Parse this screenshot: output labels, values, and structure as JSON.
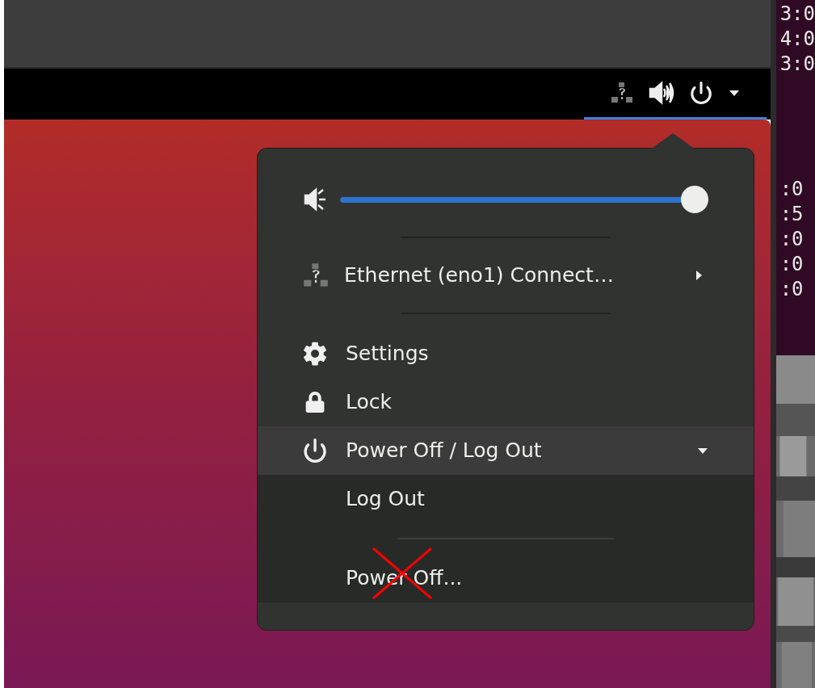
{
  "top_panel": {
    "status_menu_open": true
  },
  "menu": {
    "volume": {
      "level": 1
    },
    "network": {
      "label": "Ethernet (eno1) Connect…"
    },
    "items": [
      {
        "kind": "settings",
        "label": "Settings",
        "selected": false
      },
      {
        "kind": "lock",
        "label": "Lock",
        "selected": false
      },
      {
        "kind": "power",
        "label": "Power Off / Log Out",
        "selected": true,
        "expanded": true,
        "children": [
          {
            "label": "Log Out"
          },
          {
            "label": "Power Off..."
          }
        ]
      }
    ]
  },
  "terminal": {
    "lines_top": [
      "3:0",
      "4:0",
      "3:0"
    ],
    "lines_bottom": [
      ":0",
      ":5",
      ":0",
      ":0",
      ":0"
    ]
  }
}
